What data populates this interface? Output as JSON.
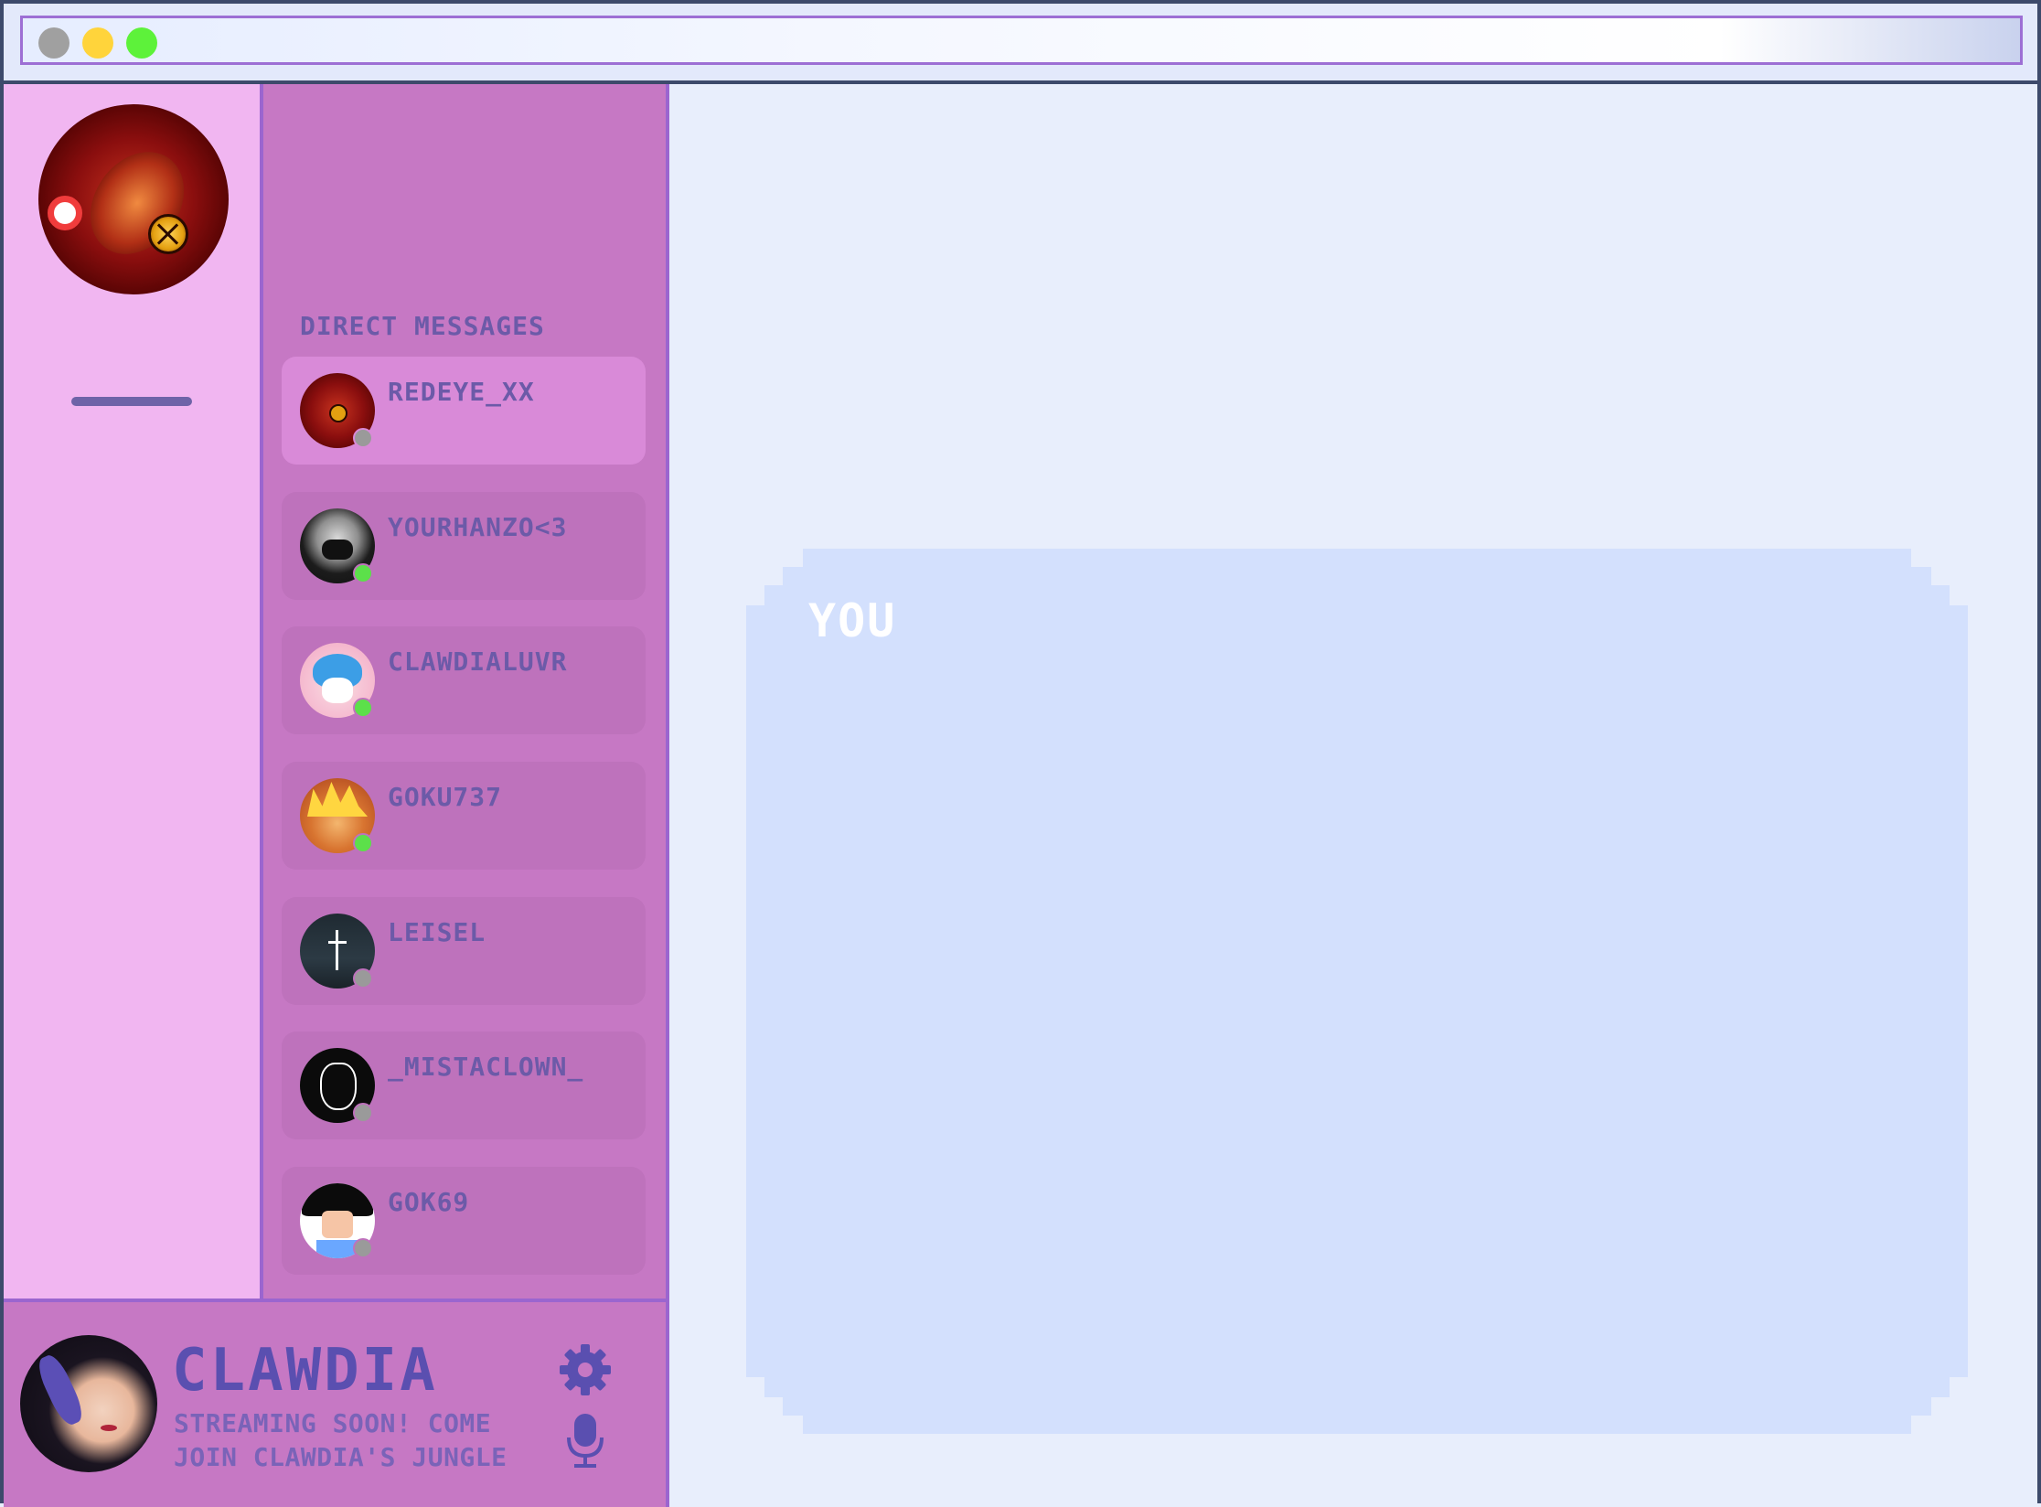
{
  "rail": {
    "server_icon": "red-eye-avatar"
  },
  "dms": {
    "heading": "DIRECT MESSAGES",
    "items": [
      {
        "name": "REDEYE_XX",
        "status": "offline",
        "active": true
      },
      {
        "name": "YOURHANZO<3",
        "status": "online",
        "active": false
      },
      {
        "name": "CLAWDIALUVR",
        "status": "online",
        "active": false
      },
      {
        "name": "GOKU737",
        "status": "online",
        "active": false
      },
      {
        "name": "LEISEL",
        "status": "offline",
        "active": false
      },
      {
        "name": "_MISTACLOWN_",
        "status": "offline",
        "active": false
      },
      {
        "name": "GOK69",
        "status": "offline",
        "active": false
      }
    ]
  },
  "user": {
    "name": "CLAWDIA",
    "status_line1": "STREAMING SOON! COME",
    "status_line2": "JOIN CLAWDIA'S JUNGLE",
    "settings_icon": "gear-icon",
    "mic_icon": "microphone-icon"
  },
  "chat": {
    "message_author": "YOU"
  },
  "colors": {
    "accent": "#5a4fb0",
    "online": "#5ce04a",
    "offline": "#9a9a9a",
    "notification": "#f03c3c"
  }
}
